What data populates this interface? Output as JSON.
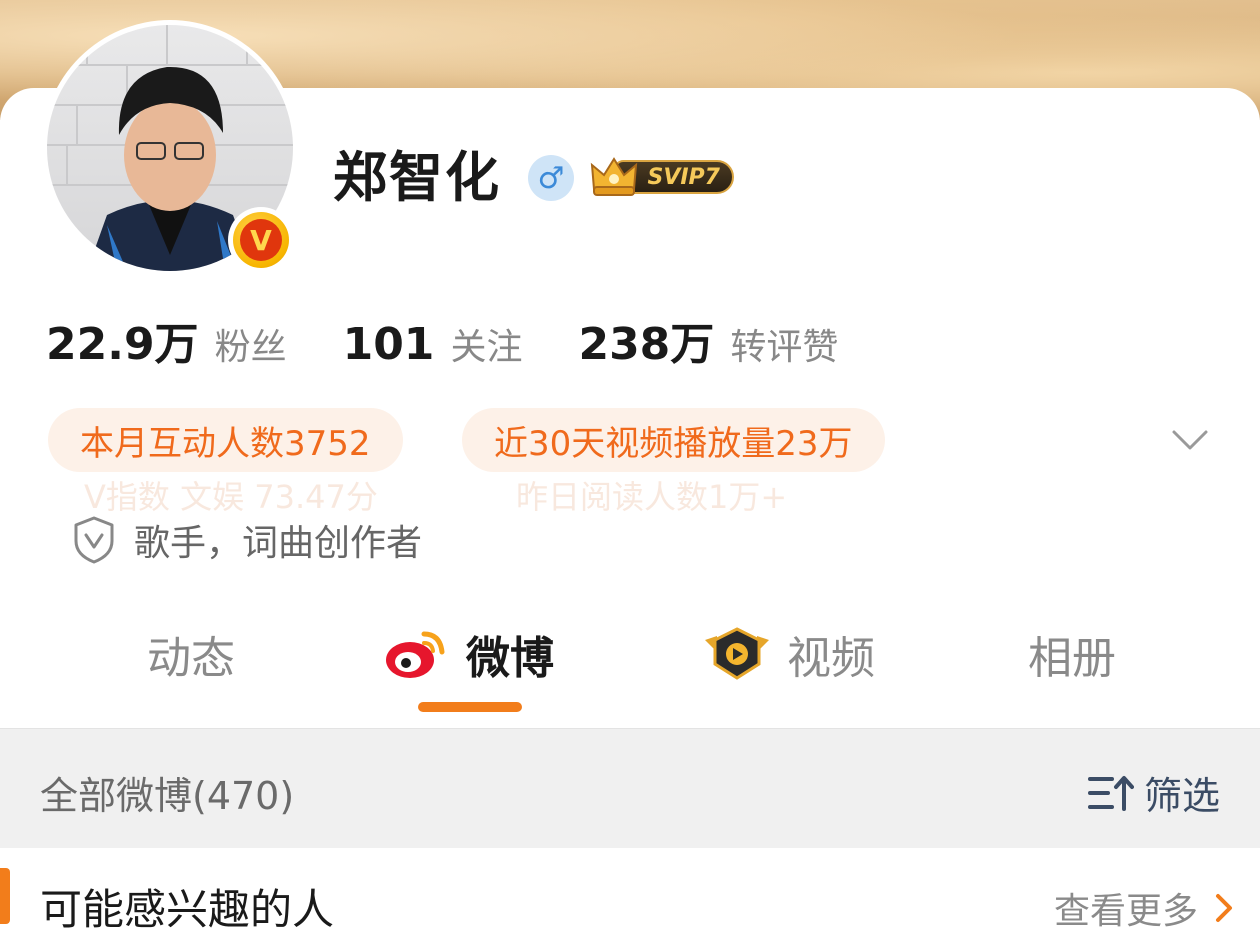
{
  "profile": {
    "name": "郑智化",
    "gender_symbol": "♂",
    "verify_letter": "V",
    "vip_label": "SVIP7"
  },
  "stats": [
    {
      "value": "22.9万",
      "label": "粉丝"
    },
    {
      "value": "101",
      "label": "关注"
    },
    {
      "value": "238万",
      "label": "转评赞"
    }
  ],
  "tags": [
    {
      "text": "本月互动人数3752"
    },
    {
      "text": "近30天视频播放量23万"
    }
  ],
  "tags_faded": [
    {
      "text": "V指数 文娱 73.47分"
    },
    {
      "text": "昨日阅读人数1万+"
    }
  ],
  "identity": "歌手，词曲创作者",
  "tabs": [
    {
      "label": "动态",
      "active": false
    },
    {
      "label": "微博",
      "active": true,
      "icon": "weibo-logo-icon"
    },
    {
      "label": "视频",
      "active": false,
      "icon": "video-play-icon"
    },
    {
      "label": "相册",
      "active": false
    }
  ],
  "filter_bar": {
    "title": "全部微博(470)",
    "filter_label": "筛选"
  },
  "suggest": {
    "title": "可能感兴趣的人",
    "more_label": "查看更多"
  },
  "colors": {
    "accent": "#f27d1b",
    "tag_text": "#f06a1c",
    "tag_bg": "#fdf1e8"
  }
}
